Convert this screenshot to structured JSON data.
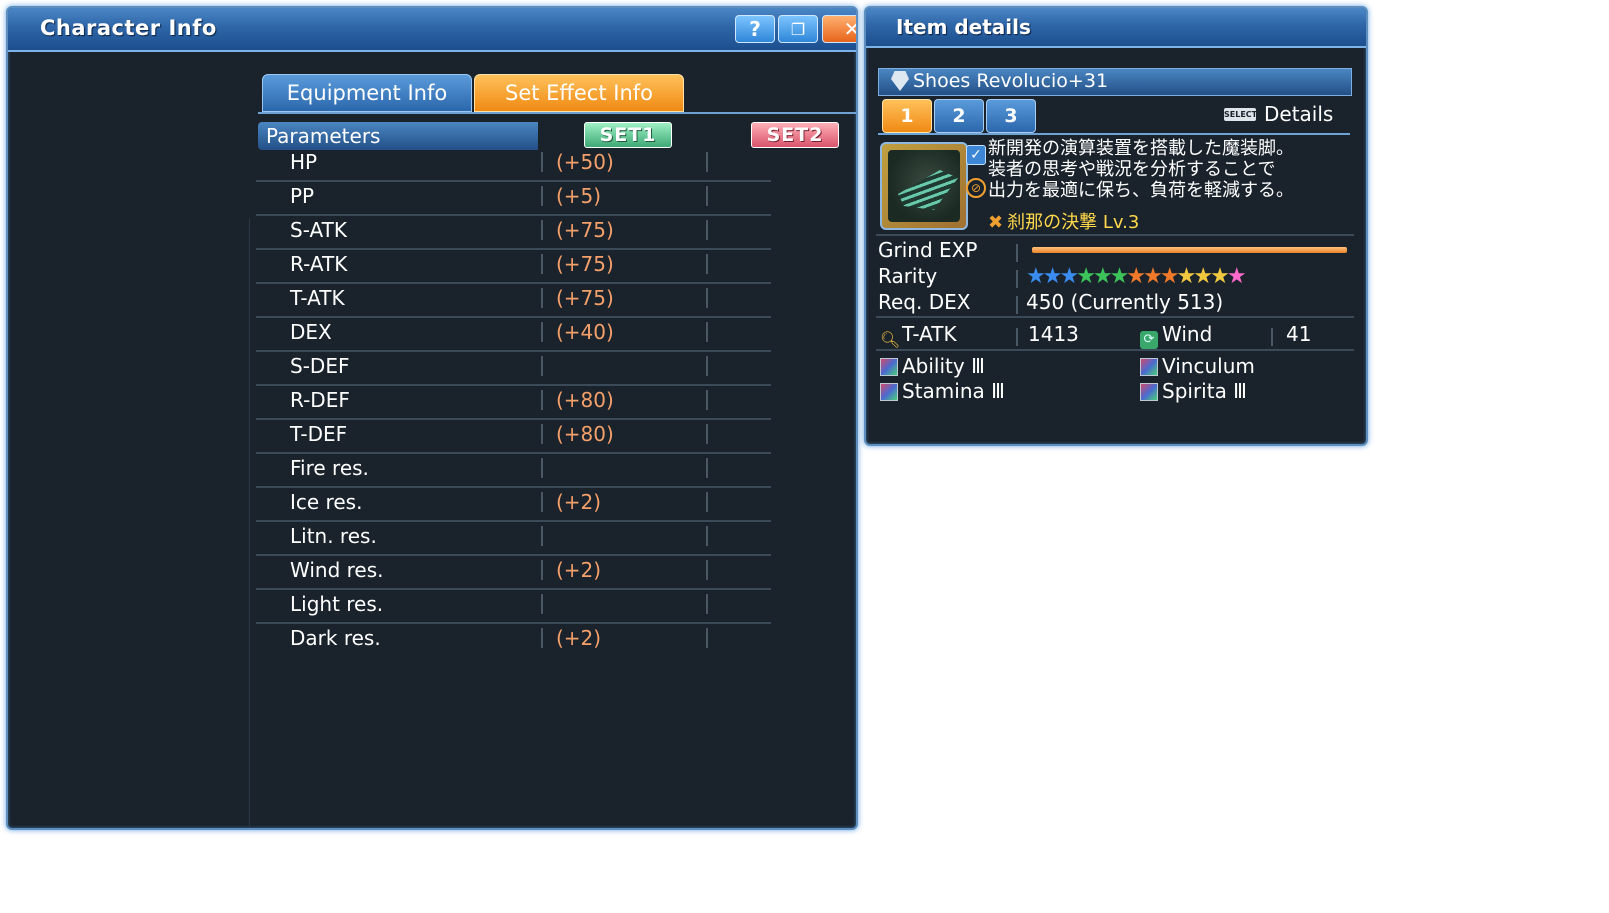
{
  "character_window": {
    "title": "Character Info",
    "buttons": {
      "help": "?",
      "minimize": "❐",
      "close": "✕"
    },
    "tabs": {
      "equipment": "Equipment Info",
      "set_effect": "Set Effect Info"
    },
    "parameters_header": "Parameters",
    "set1_label": "SET1",
    "set2_label": "SET2",
    "rows": [
      {
        "name": "HP",
        "value": "(+50)"
      },
      {
        "name": "PP",
        "value": "(+5)"
      },
      {
        "name": "S-ATK",
        "value": "(+75)"
      },
      {
        "name": "R-ATK",
        "value": "(+75)"
      },
      {
        "name": "T-ATK",
        "value": "(+75)"
      },
      {
        "name": "DEX",
        "value": "(+40)"
      },
      {
        "name": "S-DEF",
        "value": ""
      },
      {
        "name": "R-DEF",
        "value": "(+80)"
      },
      {
        "name": "T-DEF",
        "value": "(+80)"
      },
      {
        "name": "Fire res.",
        "value": ""
      },
      {
        "name": "Ice res.",
        "value": "(+2)"
      },
      {
        "name": "Litn. res.",
        "value": ""
      },
      {
        "name": "Wind res.",
        "value": "(+2)"
      },
      {
        "name": "Light res.",
        "value": ""
      },
      {
        "name": "Dark res.",
        "value": "(+2)"
      }
    ]
  },
  "item_window": {
    "title": "Item details",
    "item_name": "Shoes Revolucio+31",
    "tabs": [
      "1",
      "2",
      "3"
    ],
    "select_key": "SELECT",
    "details_label": "Details",
    "description": [
      "新開発の演算装置を搭載した魔装脚。",
      "装者の思考や戦況を分析することで",
      "出力を最適に保ち、負荷を軽減する。"
    ],
    "ability": "刹那の決撃 Lv.3",
    "grind_label": "Grind EXP",
    "grind_progress": 1.0,
    "rarity_label": "Rarity",
    "rarity_stars": "★★★★★★★★★★★★★",
    "req_label": "Req. DEX",
    "req_value": "450 (Currently 513)",
    "atk_label": "T-ATK",
    "atk_value": "1413",
    "element_label": "Wind",
    "element_value": "41",
    "affixes": [
      "Ability Ⅲ",
      "Vinculum",
      "Stamina Ⅲ",
      "Spirita Ⅲ"
    ]
  }
}
